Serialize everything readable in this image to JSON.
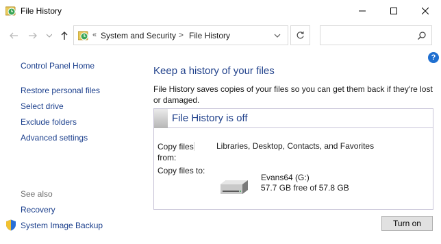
{
  "window": {
    "title": "File History"
  },
  "address": {
    "overflow_glyph": "«",
    "crumbs": [
      "System and Security",
      "File History"
    ],
    "separator": ">"
  },
  "search": {
    "placeholder": ""
  },
  "help": {
    "glyph": "?"
  },
  "sidebar": {
    "items": [
      {
        "label": "Control Panel Home"
      },
      {
        "label": "Restore personal files"
      },
      {
        "label": "Select drive"
      },
      {
        "label": "Exclude folders"
      },
      {
        "label": "Advanced settings"
      }
    ],
    "see_also_label": "See also",
    "see_also": [
      {
        "label": "Recovery"
      },
      {
        "label": "System Image Backup",
        "icon": "shield-icon"
      }
    ]
  },
  "main": {
    "heading": "Keep a history of your files",
    "description": "File History saves copies of your files so you can get them back if they're lost or damaged.",
    "status_title": "File History is off",
    "copy_from_label": "Copy files from:",
    "copy_from_value": "Libraries, Desktop, Contacts, and Favorites",
    "copy_to_label": "Copy files to:",
    "drive_name": "Evans64 (G:)",
    "drive_space": "57.7 GB free of 57.8 GB",
    "turn_on_label": "Turn on"
  },
  "colors": {
    "link": "#1a3e8c",
    "heading": "#1e3f8a",
    "help_badge": "#1f6fd0"
  }
}
